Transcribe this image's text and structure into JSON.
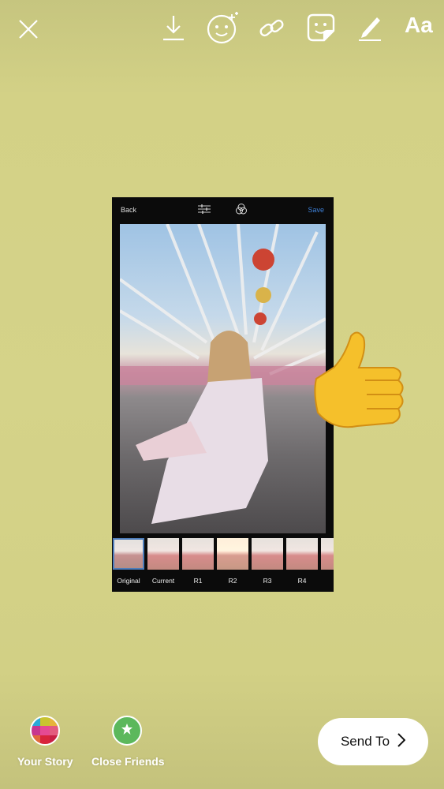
{
  "toolbar": {
    "text_label": "Aa",
    "icons": [
      "close-icon",
      "download-icon",
      "face-effects-icon",
      "link-icon",
      "sticker-icon",
      "draw-icon",
      "text-icon"
    ]
  },
  "editor": {
    "back": "Back",
    "save": "Save",
    "save_color": "#3d7fd6",
    "filters": [
      {
        "label": "Original",
        "selected": true
      },
      {
        "label": "Current"
      },
      {
        "label": "R1"
      },
      {
        "label": "R2"
      },
      {
        "label": "R3"
      },
      {
        "label": "R4"
      }
    ]
  },
  "sticker": "thumbs-up-emoji",
  "bottom": {
    "your_story": "Your Story",
    "close_friends": "Close Friends",
    "send_to": "Send To"
  },
  "colors": {
    "background": "#d4d288",
    "close_friends": "#5cb85c"
  }
}
